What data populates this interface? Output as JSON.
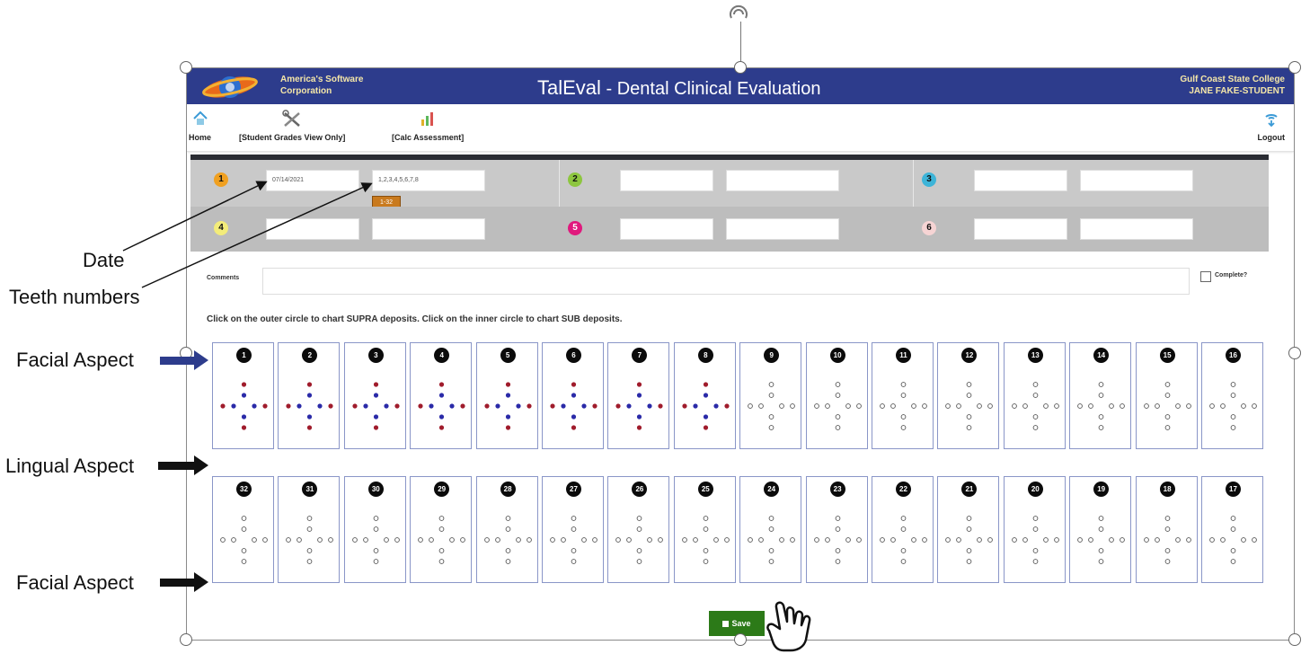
{
  "header": {
    "company_line1": "America's Software",
    "company_line2": "Corporation",
    "title_main": "TalEval",
    "title_sub": " - Dental Clinical Evaluation",
    "college": "Gulf Coast State College",
    "student": "JANE FAKE-STUDENT"
  },
  "toolbar": {
    "home_label": "Home",
    "grades_label": "[Student Grades View Only]",
    "calc_label": "[Calc Assessment]",
    "logout_label": "Logout"
  },
  "visits": {
    "n1": "1",
    "n2": "2",
    "n3": "3",
    "n4": "4",
    "n5": "5",
    "n6": "6",
    "v1_date": "07/14/2021",
    "v1_teeth": "1,2,3,4,5,6,7,8",
    "range_button": "1-32"
  },
  "comments": {
    "label": "Comments",
    "value": ""
  },
  "complete_label": "Complete?",
  "instructions": "Click on the outer circle to chart SUPRA deposits. Click on the inner circle to chart SUB deposits.",
  "teeth": {
    "top": [
      "1",
      "2",
      "3",
      "4",
      "5",
      "6",
      "7",
      "8",
      "9",
      "10",
      "11",
      "12",
      "13",
      "14",
      "15",
      "16"
    ],
    "bottom": [
      "32",
      "31",
      "30",
      "29",
      "28",
      "27",
      "26",
      "25",
      "24",
      "23",
      "22",
      "21",
      "20",
      "19",
      "18",
      "17"
    ],
    "charted_top_count": 8
  },
  "save_label": "Save",
  "annotations": {
    "date": "Date",
    "teeth_numbers": "Teeth numbers",
    "facial_aspect_top": "Facial Aspect",
    "lingual_aspect": "Lingual Aspect",
    "facial_aspect_bottom": "Facial Aspect"
  },
  "colors": {
    "header_bg": "#2d3c8c",
    "outer_dot": "#a01c2c",
    "inner_dot": "#2a2aa8",
    "save_bg": "#2c7a18",
    "visit1": "#f0a020",
    "visit2": "#8dc63f",
    "visit3": "#3db4d8",
    "visit4": "#f3ec7a",
    "visit5": "#e0197d",
    "visit6": "#f6d4d4"
  }
}
